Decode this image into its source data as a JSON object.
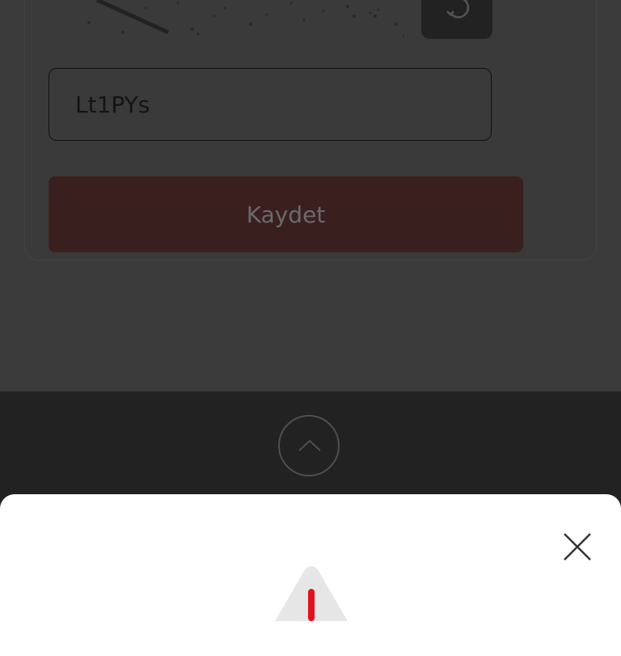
{
  "captcha": {
    "code_value": "Lt1PYs"
  },
  "form": {
    "save_label": "Kaydet"
  },
  "icons": {
    "refresh": "refresh-icon",
    "scroll_top": "chevron-up-icon",
    "close": "close-icon",
    "warning": "warning-icon"
  },
  "colors": {
    "overlay_background": "#3b3b3b",
    "save_button": "#3a1f1f",
    "warning_accent": "#e0141e",
    "modal_background": "#ffffff"
  }
}
